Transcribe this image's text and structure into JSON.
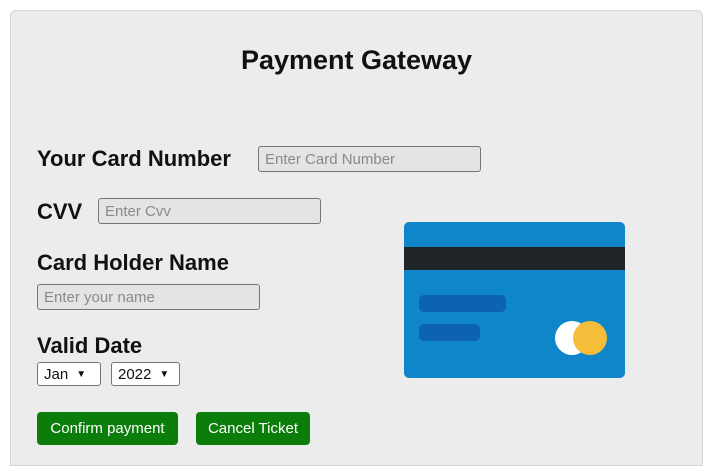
{
  "title": "Payment Gateway",
  "card_number": {
    "label": "Your Card Number",
    "placeholder": "Enter Card Number"
  },
  "cvv": {
    "label": "CVV",
    "placeholder": "Enter Cvv"
  },
  "holder": {
    "label": "Card Holder Name",
    "placeholder": "Enter your name"
  },
  "valid_date": {
    "label": "Valid Date",
    "month": "Jan",
    "year": "2022"
  },
  "buttons": {
    "confirm": "Confirm payment",
    "cancel": "Cancel Ticket"
  },
  "icons": {
    "card": "credit-card-icon",
    "chevron": "chevron-down-icon"
  },
  "colors": {
    "button": "#0a7d0a",
    "card": "#0f86c9",
    "card_accent": "#f6bd3a"
  }
}
